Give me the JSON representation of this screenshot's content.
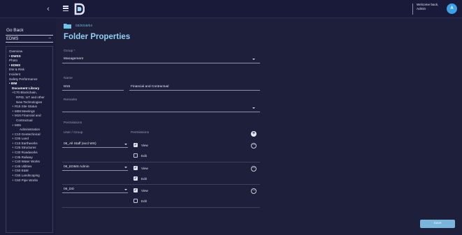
{
  "topbar": {
    "collapse_icon": "chevron-left-icon",
    "menu_icon": "hamburger-icon",
    "logo_icon": "brand-logo-icon",
    "welcome_line1": "Welcome back,",
    "welcome_line2": "Admin",
    "avatar_letter": "A"
  },
  "sidebar": {
    "go_back": "Go Back",
    "module_select": "EDMS",
    "nav": [
      {
        "label": "Overview",
        "level": 1,
        "bold": false
      },
      {
        "label": "• DWSS",
        "level": 1,
        "bold": true
      },
      {
        "label": "Photo",
        "level": 1,
        "bold": false
      },
      {
        "label": "• EDMS",
        "level": 1,
        "bold": true
      },
      {
        "label": "EW & Risk",
        "level": 1,
        "bold": false
      },
      {
        "label": "Incident",
        "level": 1,
        "bold": false
      },
      {
        "label": "Safety Performance",
        "level": 1,
        "bold": false
      },
      {
        "label": "• BIM",
        "level": 1,
        "bold": true
      },
      {
        "label": "Document Library",
        "level": 2,
        "bold": true
      },
      {
        "label": "+C70 Blockchain,",
        "level": 2,
        "bold": false
      },
      {
        "label": "RPID, IoT and other",
        "level": 3,
        "bold": false
      },
      {
        "label": "New Technologies",
        "level": 3,
        "bold": false
      },
      {
        "label": "+ R15 Site Status",
        "level": 2,
        "bold": false
      },
      {
        "label": "+ M08 Meetings",
        "level": 2,
        "bold": false
      },
      {
        "label": "+ M15 Financial and",
        "level": 2,
        "bold": false
      },
      {
        "label": "Contractual",
        "level": 3,
        "bold": false
      },
      {
        "label": "+ M05",
        "level": 2,
        "bold": false
      },
      {
        "label": "Administration",
        "level": 4,
        "bold": false
      },
      {
        "label": "+ C10 Geotechnical",
        "level": 2,
        "bold": false
      },
      {
        "label": "+ C05 Land",
        "level": 2,
        "bold": false
      },
      {
        "label": "+ C15 Earthworks",
        "level": 2,
        "bold": false
      },
      {
        "label": "+ C25 Structures",
        "level": 2,
        "bold": false
      },
      {
        "label": "+ C30 Roadworks",
        "level": 2,
        "bold": false
      },
      {
        "label": "+ C35 Railway",
        "level": 2,
        "bold": false
      },
      {
        "label": "+ C40 Water Works",
        "level": 2,
        "bold": false
      },
      {
        "label": "+ C45 Utilities",
        "level": 2,
        "bold": false
      },
      {
        "label": "+ C50 E&M",
        "level": 2,
        "bold": false
      },
      {
        "label": "+ C55 Landscaping",
        "level": 2,
        "bold": false
      },
      {
        "label": "+ C60 Pipe Works",
        "level": 2,
        "bold": false
      }
    ]
  },
  "main": {
    "breadcrumb": "03/2018/04",
    "title": "Folder Properties",
    "group_label": "Group *",
    "group_value": "Management",
    "name_label": "Name",
    "name_code": "M15",
    "name_desc": "Financial and Contractual",
    "remarks_label": "Remarks",
    "permissions_label": "Permissions",
    "col_user_group": "User / Group",
    "col_permissions": "Permissions",
    "view_label": "View",
    "edit_label": "Edit",
    "rows": [
      {
        "group": "06_All Staff (excl WS)",
        "view": true,
        "edit": false
      },
      {
        "group": "06_EDMS Admin",
        "view": true,
        "edit": true
      },
      {
        "group": "06_DD",
        "view": true,
        "edit": false
      }
    ],
    "save_label": "Save"
  },
  "colors": {
    "background": "#1e1f3a",
    "accent": "#8fd1f0",
    "save_button": "#7ab6dc",
    "avatar": "#3aa0e8"
  }
}
